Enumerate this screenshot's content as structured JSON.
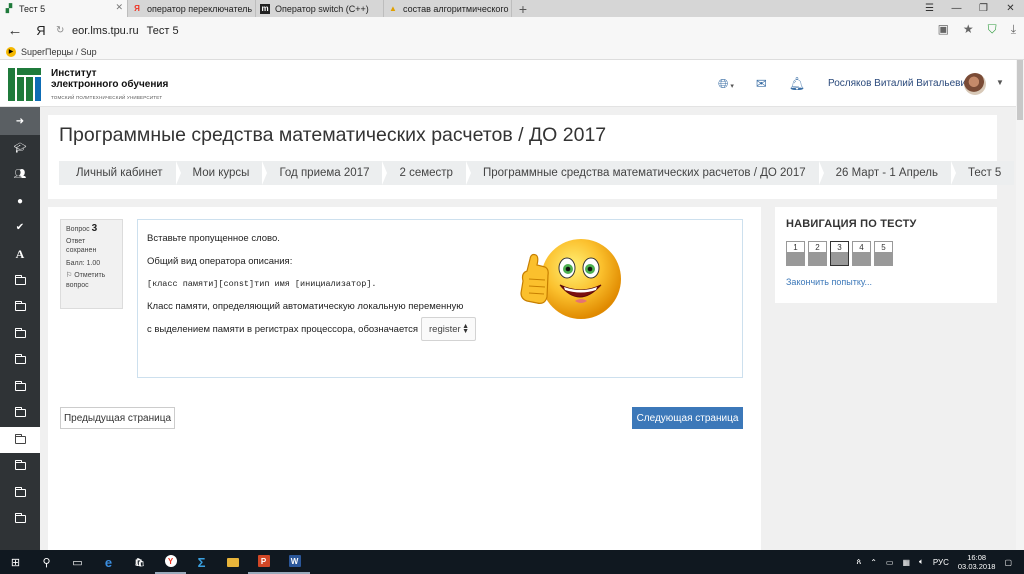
{
  "browser": {
    "tabs": [
      {
        "label": "Тест 5",
        "active": true
      },
      {
        "label": "оператор переключатель с",
        "active": false
      },
      {
        "label": "Оператор switch (C++)",
        "active": false
      },
      {
        "label": "состав алгоритмического я",
        "active": false
      }
    ],
    "address": {
      "host": "eor.lms.tpu.ru",
      "title": "Тест 5"
    },
    "bookmark": "SuperПерцы / Sup"
  },
  "site": {
    "brand_line1": "Институт",
    "brand_line2": "электронного обучения",
    "brand_line3": "ТОМСКИЙ ПОЛИТЕХНИЧЕСКИЙ УНИВЕРСИТЕТ",
    "user_name": "Росляков Виталий Витальевич"
  },
  "page": {
    "title": "Программные средства математических расчетов / ДО 2017",
    "breadcrumbs": [
      "Личный кабинет",
      "Мои курсы",
      "Год приема 2017",
      "2 семестр",
      "Программные средства математических расчетов / ДО 2017",
      "26 Март - 1 Апрель",
      "Тест 5"
    ]
  },
  "question": {
    "label": "Вопрос",
    "number": "3",
    "status": "Ответ сохранен",
    "grade": "Балл: 1.00",
    "flag": "Отметить вопрос",
    "line1": "Вставьте пропущенное слово.",
    "line2": "Общий вид оператора описания:",
    "line3": "[класс памяти][const]тип имя [инициализатор].",
    "line4": "Класс памяти, определяющий автоматическую локальную переменную",
    "line5": "с выделением памяти в регистрах процессора, обозначается как",
    "answer": "register"
  },
  "buttons": {
    "prev": "Предыдущая страница",
    "next": "Следующая страница"
  },
  "quiz_nav": {
    "title": "НАВИГАЦИЯ ПО ТЕСТУ",
    "pages": [
      "1",
      "2",
      "3",
      "4",
      "5"
    ],
    "current": 3,
    "finish": "Закончить попытку..."
  },
  "taskbar": {
    "lang": "РУС",
    "time": "16:08",
    "date": "03.03.2018"
  },
  "colors": {
    "accent_blue": "#3c78b9",
    "sidebar_dark": "#2f3336",
    "logo_green": "#1f7a3b"
  }
}
